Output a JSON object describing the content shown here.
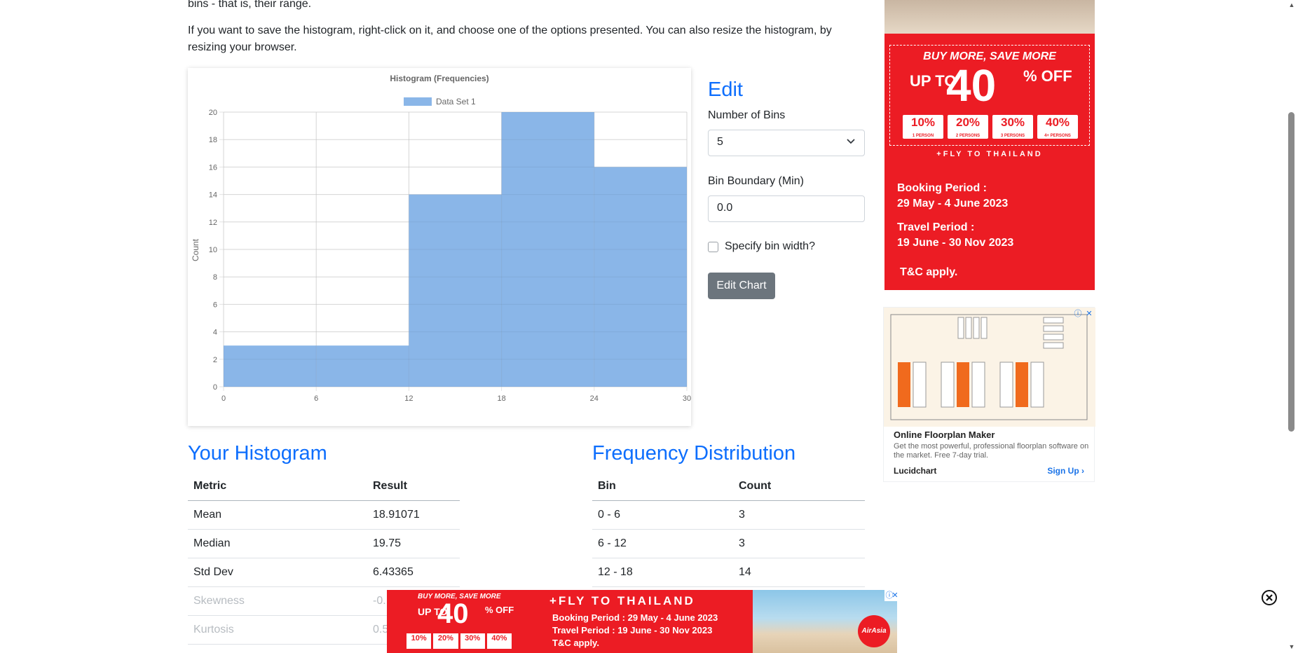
{
  "intro": {
    "line1": "bins - that is, their range.",
    "line2": "If you want to save the histogram, right-click on it, and choose one of the options presented. You can also resize the histogram, by resizing your browser."
  },
  "chart_data": {
    "type": "bar",
    "title": "Histogram (Frequencies)",
    "xlabel": "",
    "ylabel": "Count",
    "bin_edges": [
      0,
      6,
      12,
      18,
      24,
      30
    ],
    "series": [
      {
        "name": "Data Set 1",
        "values": [
          3,
          3,
          14,
          20,
          16
        ]
      }
    ],
    "xticks": [
      "0",
      "6",
      "12",
      "18",
      "24",
      "30"
    ],
    "yticks": [
      "0",
      "2",
      "4",
      "6",
      "8",
      "10",
      "12",
      "14",
      "16",
      "18",
      "20"
    ],
    "xlim": [
      0,
      30
    ],
    "ylim": [
      0,
      20
    ],
    "grid": true,
    "legend_position": "top",
    "color": "#8ab6e8"
  },
  "edit": {
    "title": "Edit",
    "bins_label": "Number of Bins",
    "bins_value": "5",
    "boundary_label": "Bin Boundary (Min)",
    "boundary_value": "0.0",
    "checkbox_label": "Specify bin width?",
    "button_label": "Edit Chart"
  },
  "histogram_stats": {
    "title": "Your Histogram",
    "headers": [
      "Metric",
      "Result"
    ],
    "rows": [
      [
        "Mean",
        "18.91071"
      ],
      [
        "Median",
        "19.75"
      ],
      [
        "Std Dev",
        "6.43365"
      ],
      [
        "Skewness",
        "-0."
      ],
      [
        "Kurtosis",
        "0.5"
      ]
    ]
  },
  "frequency_distribution": {
    "title": "Frequency Distribution",
    "headers": [
      "Bin",
      "Count"
    ],
    "rows": [
      [
        "0 - 6",
        "3"
      ],
      [
        "6 - 12",
        "3"
      ],
      [
        "12 - 18",
        "14"
      ]
    ]
  },
  "ad_right": {
    "buy_more": "BUY MORE, SAVE MORE",
    "up_to": "UP TO",
    "big_number": "40",
    "pct_off": "% OFF",
    "chips": [
      {
        "pct": "10%",
        "label": "1 PERSON"
      },
      {
        "pct": "20%",
        "label": "2 PERSONS"
      },
      {
        "pct": "30%",
        "label": "3 PERSONS"
      },
      {
        "pct": "40%",
        "label": "4+ PERSONS"
      }
    ],
    "fly": "+FLY TO THAILAND",
    "booking_title": "Booking Period :",
    "booking_dates": "29 May - 4 June 2023",
    "travel_title": "Travel Period :",
    "travel_dates": "19 June - 30 Nov 2023",
    "tc": "T&C apply."
  },
  "ad_floorplan": {
    "title": "Online Floorplan Maker",
    "description": "Get the most powerful, professional floorplan software on the market. Free 7-day trial.",
    "brand": "Lucidchart",
    "cta": "Sign Up"
  },
  "ad_bottom": {
    "buy_more": "BUY MORE, SAVE MORE",
    "up_to": "UP TO",
    "big_number": "40",
    "pct_off": "% OFF",
    "chips": [
      "10%",
      "20%",
      "30%",
      "40%"
    ],
    "fly": "+FLY TO THAILAND",
    "booking": "Booking Period : 29 May - 4 June 2023",
    "travel": "Travel Period : 19 June - 30 Nov 2023",
    "tc": "T&C apply.",
    "brand": "AirAsia"
  },
  "colors": {
    "accent": "#0d6efd",
    "bar": "#8ab6e8",
    "ad_red": "#ec1c24",
    "button_gray": "#6c757d"
  }
}
